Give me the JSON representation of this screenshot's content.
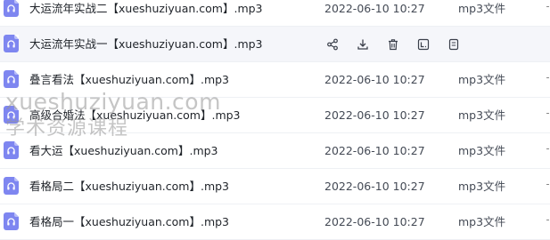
{
  "files": [
    {
      "name": "大运流年实战二【xueshuziyuan.com】.mp3",
      "modified": "2022-06-10 10:27",
      "type": "mp3文件",
      "icon": "audio-file-icon"
    },
    {
      "name": "大运流年实战一【xueshuziyuan.com】.mp3",
      "modified": "",
      "type": "",
      "icon": "audio-file-icon",
      "hovered": true
    },
    {
      "name": "叠言看法【xueshuziyuan.com】.mp3",
      "modified": "2022-06-10 10:27",
      "type": "mp3文件",
      "icon": "audio-file-icon"
    },
    {
      "name": "高级合婚法【xueshuziyuan.com】.mp3",
      "modified": "2022-06-10 10:27",
      "type": "mp3文件",
      "icon": "audio-file-icon"
    },
    {
      "name": "看大运【xueshuziyuan.com】.mp3",
      "modified": "2022-06-10 10:27",
      "type": "mp3文件",
      "icon": "audio-file-icon"
    },
    {
      "name": "看格局二【xueshuziyuan.com】.mp3",
      "modified": "2022-06-10 10:27",
      "type": "mp3文件",
      "icon": "audio-file-icon"
    },
    {
      "name": "看格局一【xueshuziyuan.com】.mp3",
      "modified": "2022-06-10 10:27",
      "type": "mp3文件",
      "icon": "audio-file-icon"
    }
  ],
  "hover_actions": [
    {
      "icon": "share-icon"
    },
    {
      "icon": "download-icon"
    },
    {
      "icon": "delete-icon"
    },
    {
      "icon": "rename-icon"
    },
    {
      "icon": "more-info-icon"
    }
  ],
  "watermark": {
    "line1": "xueshuziyuan.com",
    "line2": "学术资源课程"
  },
  "colors": {
    "file_icon": "#7e86f0",
    "hover_row": "#f5f6fa",
    "text": "#1f2329",
    "action_icon": "#3a3f4a"
  }
}
